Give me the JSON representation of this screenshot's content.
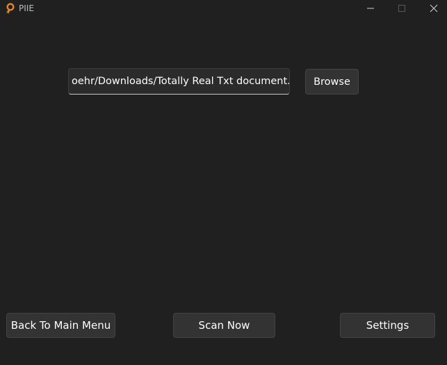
{
  "window": {
    "title": "PIIE",
    "icon": "ribbon-award-icon",
    "accent_color": "#e8871e"
  },
  "file_picker": {
    "path_value": "oehr/Downloads/Totally Real Txt document.txt",
    "browse_label": "Browse"
  },
  "footer": {
    "back_label": "Back To Main Menu",
    "scan_label": "Scan Now",
    "settings_label": "Settings"
  }
}
